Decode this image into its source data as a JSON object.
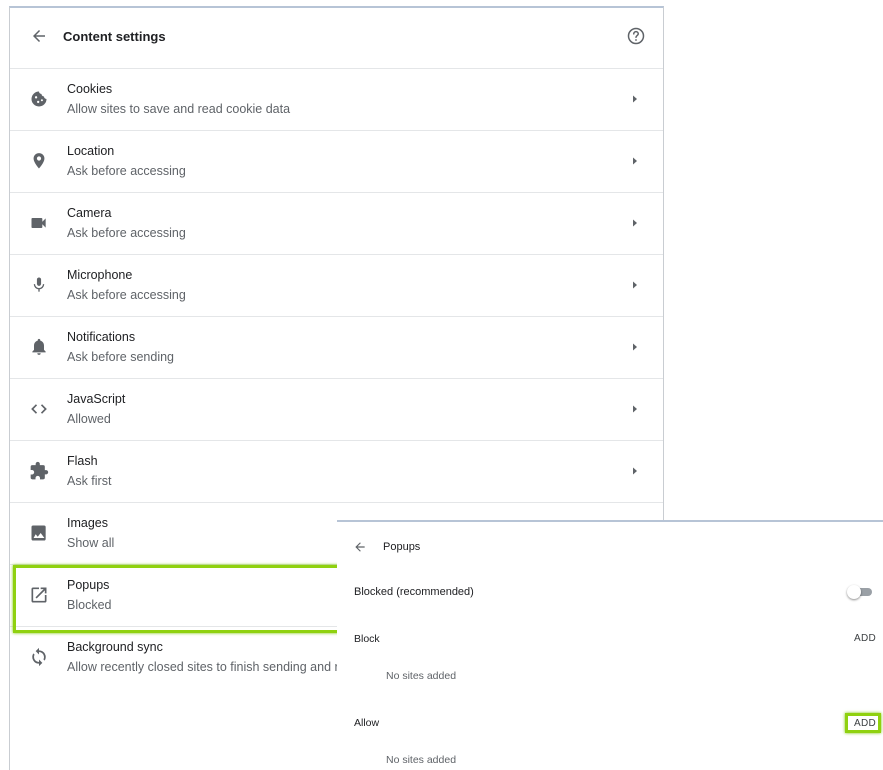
{
  "header": {
    "title": "Content settings",
    "back_icon": "arrow-left-icon",
    "help_icon": "help-circle-icon"
  },
  "settings": [
    {
      "key": "cookies",
      "title": "Cookies",
      "subtitle": "Allow sites to save and read cookie data",
      "icon": "cookie-icon"
    },
    {
      "key": "location",
      "title": "Location",
      "subtitle": "Ask before accessing",
      "icon": "location-pin-icon"
    },
    {
      "key": "camera",
      "title": "Camera",
      "subtitle": "Ask before accessing",
      "icon": "camera-icon"
    },
    {
      "key": "microphone",
      "title": "Microphone",
      "subtitle": "Ask before accessing",
      "icon": "microphone-icon"
    },
    {
      "key": "notifications",
      "title": "Notifications",
      "subtitle": "Ask before sending",
      "icon": "bell-icon"
    },
    {
      "key": "javascript",
      "title": "JavaScript",
      "subtitle": "Allowed",
      "icon": "code-icon"
    },
    {
      "key": "flash",
      "title": "Flash",
      "subtitle": "Ask first",
      "icon": "puzzle-icon"
    },
    {
      "key": "images",
      "title": "Images",
      "subtitle": "Show all",
      "icon": "image-icon"
    },
    {
      "key": "popups",
      "title": "Popups",
      "subtitle": "Blocked",
      "icon": "open-in-new-icon"
    },
    {
      "key": "background-sync",
      "title": "Background sync",
      "subtitle": "Allow recently closed sites to finish sending and r",
      "icon": "sync-icon"
    }
  ],
  "popups": {
    "title": "Popups",
    "blocked_label": "Blocked (recommended)",
    "toggle_on": false,
    "block": {
      "label": "Block",
      "add_label": "ADD",
      "empty_text": "No sites added"
    },
    "allow": {
      "label": "Allow",
      "add_label": "ADD",
      "empty_text": "No sites added"
    }
  },
  "colors": {
    "highlight": "#8fd10f",
    "icon": "#5f6368",
    "text_primary": "#202124",
    "text_secondary": "#5f6368"
  }
}
